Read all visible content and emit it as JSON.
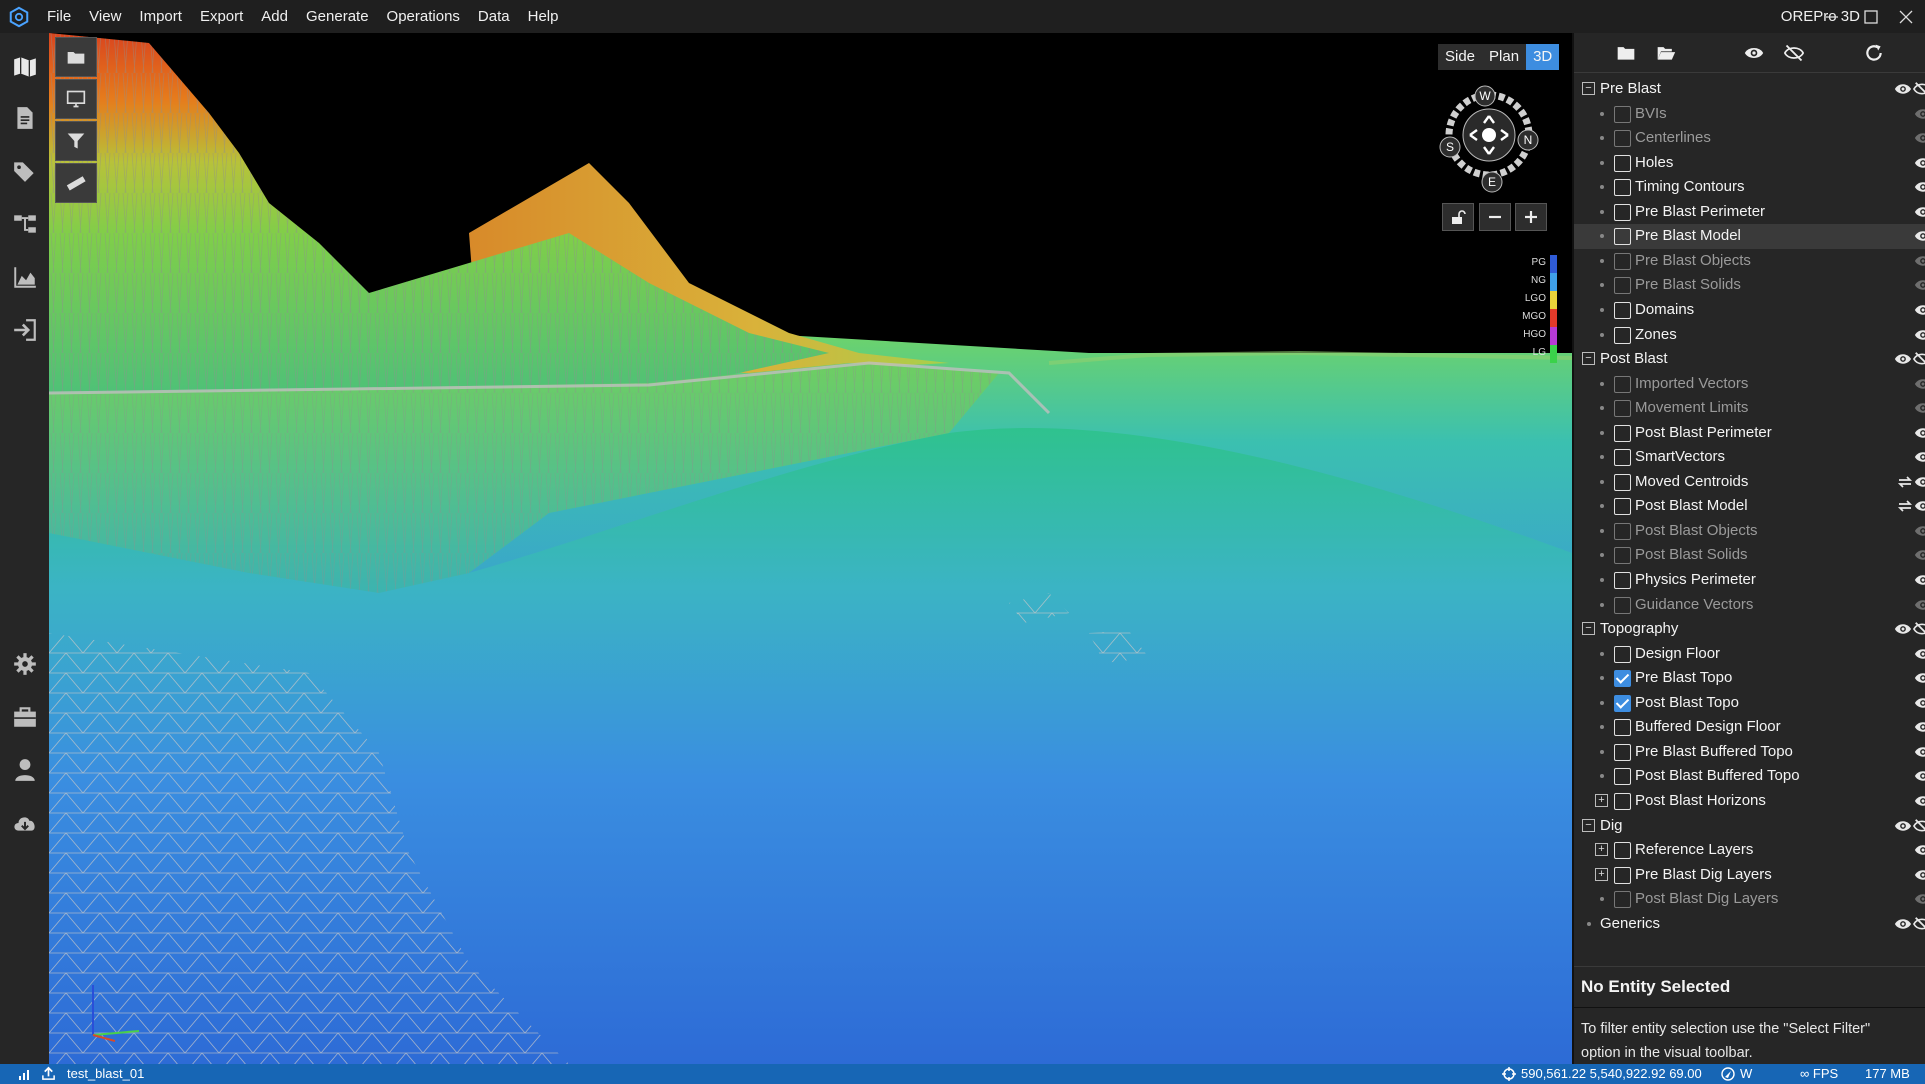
{
  "app": {
    "title": "OREPro 3D"
  },
  "menu": [
    "File",
    "View",
    "Import",
    "Export",
    "Add",
    "Generate",
    "Operations",
    "Data",
    "Help"
  ],
  "left_rail": {
    "top_icons": [
      "map-icon",
      "document-icon",
      "tags-icon",
      "hierarchy-icon",
      "area-chart-icon",
      "import-icon"
    ],
    "bottom_icons": [
      "settings-gear-icon",
      "toolbox-icon",
      "user-icon",
      "cloud-download-icon"
    ]
  },
  "viewport": {
    "toolbar_icons": [
      "folder-icon",
      "monitor-icon",
      "filter-icon",
      "ruler-icon"
    ],
    "view_modes": [
      {
        "label": "Side",
        "active": false
      },
      {
        "label": "Plan",
        "active": false
      },
      {
        "label": "3D",
        "active": true
      }
    ],
    "compass": {
      "top": "W",
      "right": "N",
      "bottom": "E",
      "left": "S"
    },
    "legend": [
      {
        "label": "PG",
        "color": "#2f5bd6"
      },
      {
        "label": "NG",
        "color": "#3fa0e8"
      },
      {
        "label": "LGO",
        "color": "#e8d23a"
      },
      {
        "label": "MGO",
        "color": "#e23a2a"
      },
      {
        "label": "HGO",
        "color": "#b63ad4"
      },
      {
        "label": "LG",
        "color": "#3ad24a"
      }
    ]
  },
  "panel": {
    "toolbar_icons": [
      "folder-icon",
      "folder-open-icon",
      "show-all-icon",
      "hide-all-icon",
      "refresh-icon"
    ],
    "tree": [
      {
        "label": "Pre Blast",
        "type": "group",
        "expander": "−"
      },
      {
        "label": "BVIs",
        "type": "item",
        "checked": false,
        "enabled": false
      },
      {
        "label": "Centerlines",
        "type": "item",
        "checked": false,
        "enabled": false
      },
      {
        "label": "Holes",
        "type": "item",
        "checked": false,
        "enabled": true
      },
      {
        "label": "Timing Contours",
        "type": "item",
        "checked": false,
        "enabled": true
      },
      {
        "label": "Pre Blast Perimeter",
        "type": "item",
        "checked": false,
        "enabled": true
      },
      {
        "label": "Pre Blast Model",
        "type": "item",
        "checked": false,
        "enabled": true,
        "highlighted": true
      },
      {
        "label": "Pre Blast Objects",
        "type": "item",
        "checked": false,
        "enabled": false
      },
      {
        "label": "Pre Blast Solids",
        "type": "item",
        "checked": false,
        "enabled": false
      },
      {
        "label": "Domains",
        "type": "item",
        "checked": false,
        "enabled": true
      },
      {
        "label": "Zones",
        "type": "item",
        "checked": false,
        "enabled": true
      },
      {
        "label": "Post Blast",
        "type": "group",
        "expander": "−"
      },
      {
        "label": "Imported Vectors",
        "type": "item",
        "checked": false,
        "enabled": false
      },
      {
        "label": "Movement Limits",
        "type": "item",
        "checked": false,
        "enabled": false
      },
      {
        "label": "Post Blast Perimeter",
        "type": "item",
        "checked": false,
        "enabled": true
      },
      {
        "label": "SmartVectors",
        "type": "item",
        "checked": false,
        "enabled": true
      },
      {
        "label": "Moved Centroids",
        "type": "item",
        "checked": false,
        "enabled": true,
        "refresh": true
      },
      {
        "label": "Post Blast Model",
        "type": "item",
        "checked": false,
        "enabled": true,
        "refresh": true
      },
      {
        "label": "Post Blast Objects",
        "type": "item",
        "checked": false,
        "enabled": false
      },
      {
        "label": "Post Blast Solids",
        "type": "item",
        "checked": false,
        "enabled": false
      },
      {
        "label": "Physics Perimeter",
        "type": "item",
        "checked": false,
        "enabled": true
      },
      {
        "label": "Guidance Vectors",
        "type": "item",
        "checked": false,
        "enabled": false
      },
      {
        "label": "Topography",
        "type": "group",
        "expander": "−"
      },
      {
        "label": "Design Floor",
        "type": "item",
        "checked": false,
        "enabled": true
      },
      {
        "label": "Pre Blast Topo",
        "type": "item",
        "checked": true,
        "enabled": true
      },
      {
        "label": "Post Blast Topo",
        "type": "item",
        "checked": true,
        "enabled": true
      },
      {
        "label": "Buffered Design Floor",
        "type": "item",
        "checked": false,
        "enabled": true
      },
      {
        "label": "Pre Blast Buffered Topo",
        "type": "item",
        "checked": false,
        "enabled": true
      },
      {
        "label": "Post Blast Buffered Topo",
        "type": "item",
        "checked": false,
        "enabled": true
      },
      {
        "label": "Post Blast Horizons",
        "type": "item",
        "checked": false,
        "enabled": true,
        "expander": "+"
      },
      {
        "label": "Dig",
        "type": "group",
        "expander": "−"
      },
      {
        "label": "Reference Layers",
        "type": "item",
        "checked": false,
        "enabled": true,
        "expander": "+"
      },
      {
        "label": "Pre Blast Dig Layers",
        "type": "item",
        "checked": false,
        "enabled": true,
        "expander": "+"
      },
      {
        "label": "Post Blast Dig Layers",
        "type": "item",
        "checked": false,
        "enabled": false
      },
      {
        "label": "Generics",
        "type": "group",
        "expander": null
      }
    ],
    "selection": {
      "title": "No Entity Selected",
      "help": "To filter entity selection use the \"Select Filter\" option in the visual toolbar."
    }
  },
  "status": {
    "file": "test_blast_01",
    "coordinates": "590,561.22 5,540,922.92 69.00",
    "direction": "W",
    "fps_label": "∞ FPS",
    "memory": "177 MB"
  },
  "colors": {
    "accent": "#3d8de0",
    "status_bar": "#1766b5",
    "panel_bg": "#262626",
    "titlebar_bg": "#1f1f1f"
  }
}
